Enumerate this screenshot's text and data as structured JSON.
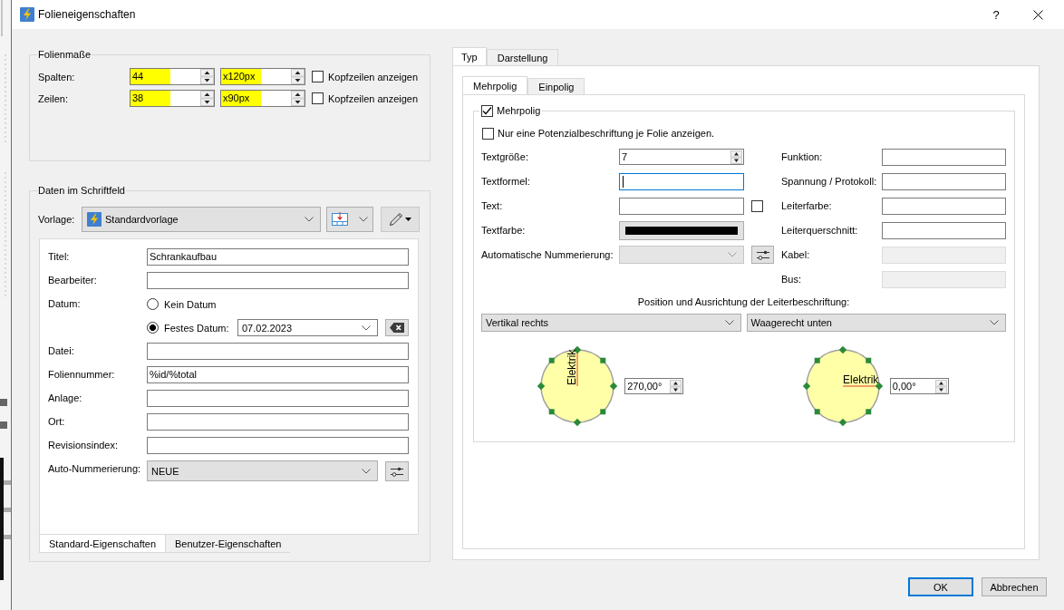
{
  "window": {
    "title": "Folieneigenschaften",
    "help_label": "?"
  },
  "sheet_size": {
    "title": "Folienmaße",
    "rows": [
      {
        "label": "Spalten:",
        "count": {
          "value": "44",
          "highlighted": true
        },
        "size": {
          "value": "x120px",
          "highlighted": true
        },
        "header_checkbox": {
          "label": "Kopfzeilen anzeigen",
          "checked": false
        }
      },
      {
        "label": "Zeilen:",
        "count": {
          "value": "38",
          "highlighted": true
        },
        "size": {
          "value": "x90px",
          "highlighted": true
        },
        "header_checkbox": {
          "label": "Kopfzeilen anzeigen",
          "checked": false
        }
      }
    ]
  },
  "title_block": {
    "title": "Daten im Schriftfeld",
    "template": {
      "label": "Vorlage:",
      "value": "Standardvorlage"
    },
    "fields": [
      {
        "kind": "text",
        "label": "Titel:",
        "value": "Schrankaufbau"
      },
      {
        "kind": "text",
        "label": "Bearbeiter:"
      },
      {
        "kind": "date",
        "label": "Datum:",
        "options": [
          {
            "label": "Kein Datum",
            "selected": false
          },
          {
            "label": "Festes Datum:",
            "selected": true,
            "value": "07.02.2023"
          }
        ]
      },
      {
        "kind": "text",
        "label": "Datei:"
      },
      {
        "kind": "text",
        "label": "Foliennummer:",
        "value": "%id/%total"
      },
      {
        "kind": "text",
        "label": "Anlage:"
      },
      {
        "kind": "text",
        "label": "Ort:"
      },
      {
        "kind": "text",
        "label": "Revisionsindex:"
      },
      {
        "kind": "combo",
        "label": "Auto-Nummerierung:",
        "value": "NEUE"
      }
    ],
    "tabs": [
      {
        "label": "Standard-Eigenschaften",
        "selected": true
      },
      {
        "label": "Benutzer-Eigenschaften",
        "selected": false
      }
    ]
  },
  "conductor": {
    "tabs": [
      {
        "label": "Typ",
        "selected": true
      },
      {
        "label": "Darstellung",
        "selected": false
      }
    ],
    "subtabs": [
      {
        "label": "Mehrpolig",
        "selected": true
      },
      {
        "label": "Einpolig",
        "selected": false
      }
    ],
    "group": {
      "label": "Mehrpolig",
      "checked": true
    },
    "single_label": {
      "label": "Nur eine Potenzialbeschriftung je Folie anzeigen.",
      "checked": false
    },
    "left_fields": [
      {
        "kind": "spin",
        "label": "Textgröße:",
        "value": "7",
        "focused": false,
        "disabled": false
      },
      {
        "kind": "text",
        "label": "Textformel:",
        "focused": true,
        "disabled": false
      },
      {
        "kind": "text_check",
        "label": "Text:",
        "checked": false,
        "focused": false,
        "disabled": false
      },
      {
        "kind": "color",
        "label": "Textfarbe:",
        "color": "#000000",
        "focused": false,
        "disabled": false
      },
      {
        "kind": "combo",
        "label": "Automatische Nummerierung:",
        "focused": false,
        "disabled": true
      }
    ],
    "right_fields": [
      {
        "label": "Funktion:",
        "disabled": false
      },
      {
        "label": "Spannung / Protokoll:",
        "disabled": false
      },
      {
        "label": "Leiterfarbe:",
        "disabled": false
      },
      {
        "label": "Leiterquerschnitt:",
        "disabled": false
      },
      {
        "label": "Kabel:",
        "disabled": true
      },
      {
        "label": "Bus:",
        "disabled": true
      }
    ],
    "position_title": "Position und Ausrichtung der Leiterbeschriftung:",
    "orientation_dropdowns": [
      "Vertikal rechts",
      "Waagerecht unten"
    ],
    "dials": [
      {
        "kind": "vertical",
        "label": "Elektrik",
        "angle": "270,00°"
      },
      {
        "kind": "horizontal",
        "label": "Elektrik",
        "angle": "0,00°"
      }
    ]
  },
  "buttons": [
    {
      "label": "OK",
      "default": true
    },
    {
      "label": "Abbrechen",
      "default": false
    }
  ]
}
